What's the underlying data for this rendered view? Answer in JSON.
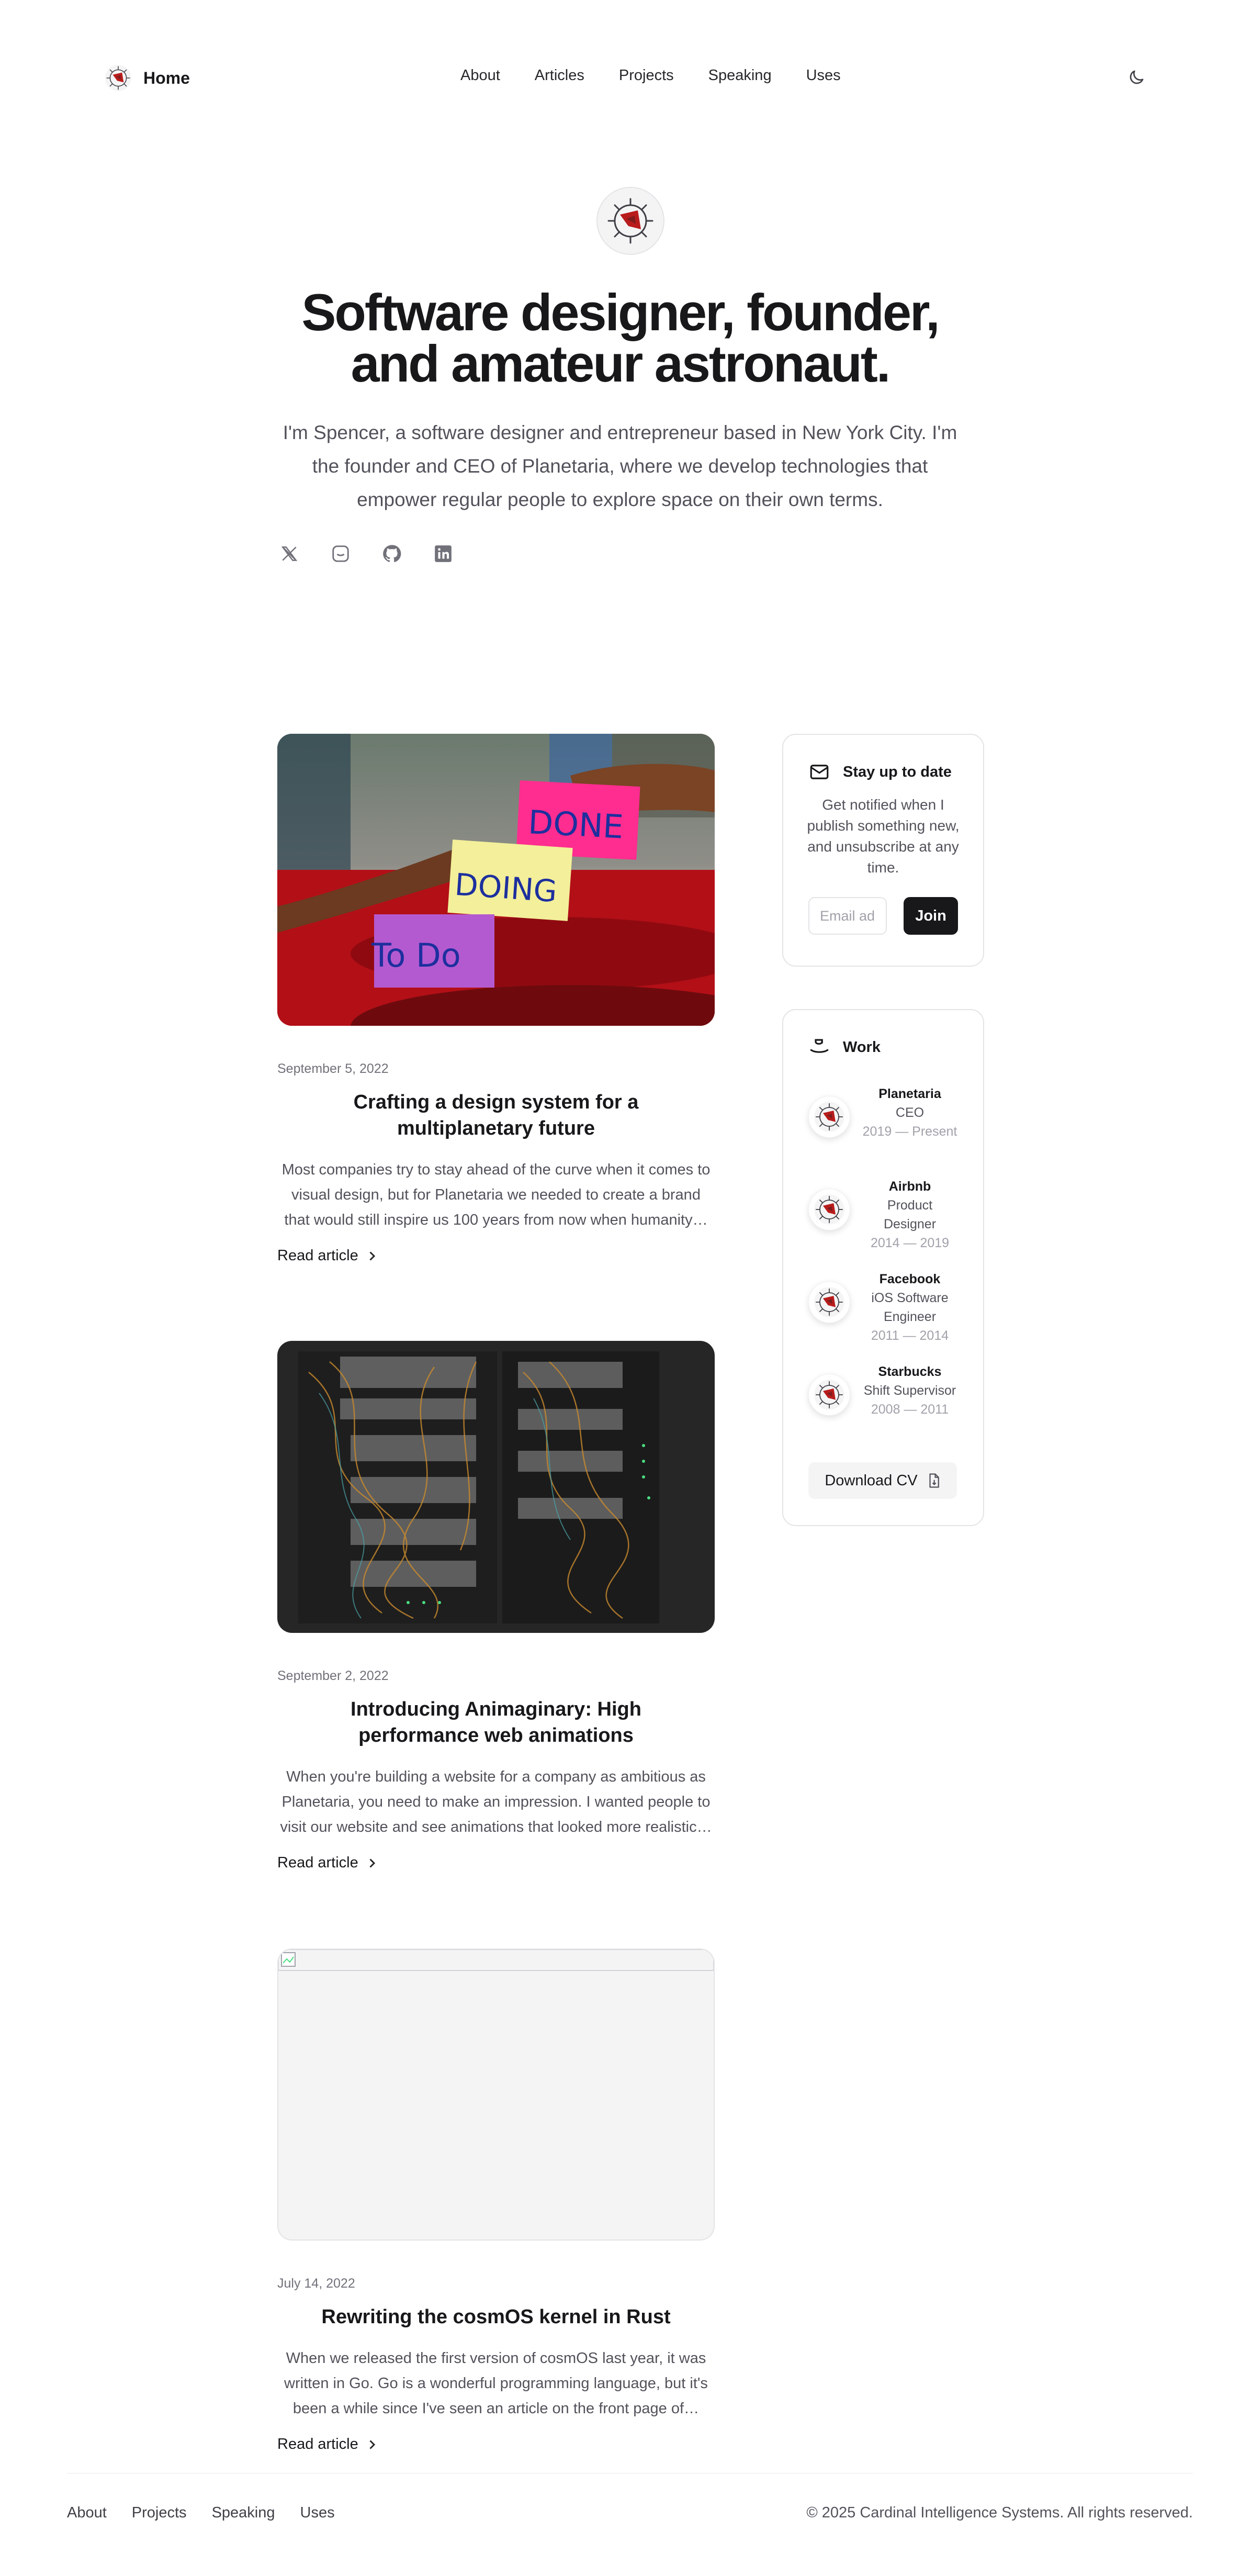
{
  "header": {
    "brand_label": "Home",
    "nav": [
      "About",
      "Articles",
      "Projects",
      "Speaking",
      "Uses"
    ],
    "theme_icon": "moon-icon"
  },
  "hero": {
    "title": "Software designer, founder, and amateur astronaut.",
    "description": "I'm Spencer, a software designer and entrepreneur based in New York City. I'm the founder and CEO of Planetaria, where we develop technologies that empower regular people to explore space on their own terms.",
    "socials": [
      "x-icon",
      "instagram-icon",
      "github-icon",
      "linkedin-icon"
    ]
  },
  "articles": [
    {
      "date": "September 5, 2022",
      "title": "Crafting a design system for a multiplanetary future",
      "excerpt": "Most companies try to stay ahead of the curve when it comes to visual design, but for Planetaria we needed to create a brand that would still inspire us 100 years from now when humanity…",
      "read_more": "Read article",
      "image": "sticky-notes-photo"
    },
    {
      "date": "September 2, 2022",
      "title": "Introducing Animaginary: High performance web animations",
      "excerpt": "When you're building a website for a company as ambitious as Planetaria, you need to make an impression. I wanted people to visit our website and see animations that looked more realistic…",
      "read_more": "Read article",
      "image": "server-rack-photo"
    },
    {
      "date": "July 14, 2022",
      "title": "Rewriting the cosmOS kernel in Rust",
      "excerpt": "When we released the first version of cosmOS last year, it was written in Go. Go is a wonderful programming language, but it's been a while since I've seen an article on the front page of…",
      "read_more": "Read article",
      "image": "broken-image"
    }
  ],
  "newsletter": {
    "title": "Stay up to date",
    "description": "Get notified when I publish something new, and unsubscribe at any time.",
    "email_placeholder": "Email address",
    "join_label": "Join"
  },
  "work": {
    "title": "Work",
    "items": [
      {
        "company": "Planetaria",
        "role": "CEO",
        "dates": "2019 — Present"
      },
      {
        "company": "Airbnb",
        "role": "Product Designer",
        "dates": "2014 — 2019"
      },
      {
        "company": "Facebook",
        "role": "iOS Software Engineer",
        "dates": "2011 — 2014"
      },
      {
        "company": "Starbucks",
        "role": "Shift Supervisor",
        "dates": "2008 — 2011"
      }
    ],
    "download_label": "Download CV"
  },
  "footer": {
    "nav": [
      "About",
      "Projects",
      "Speaking",
      "Uses"
    ],
    "copyright": "© 2025 Cardinal Intelligence Systems. All rights reserved."
  },
  "colors": {
    "text": "#18181b",
    "muted": "#52525b",
    "accent_dark": "#18181b",
    "border": "#e4e4e7"
  }
}
